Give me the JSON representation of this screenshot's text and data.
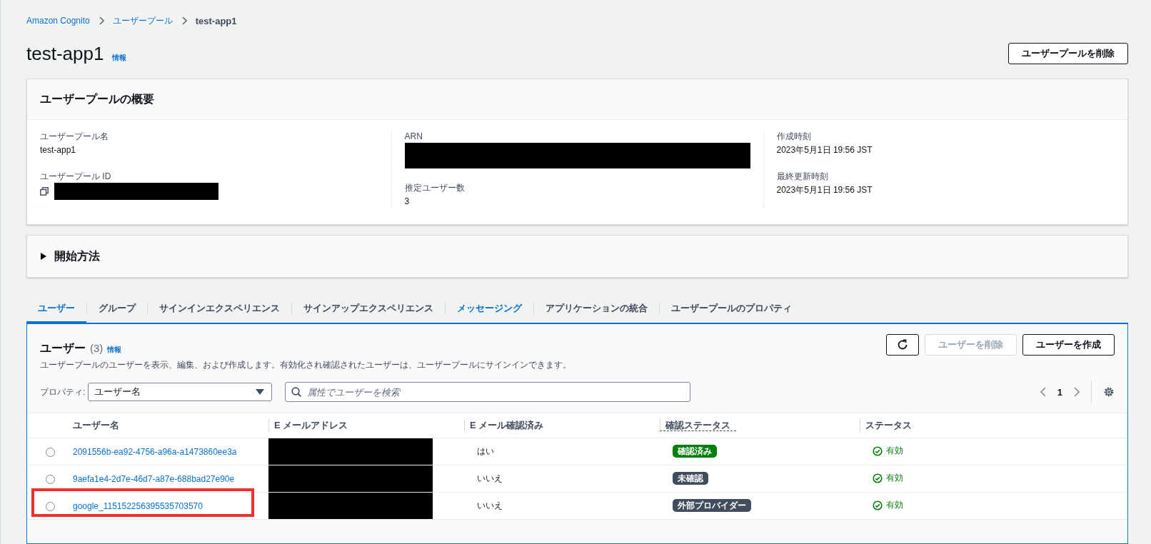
{
  "breadcrumbs": [
    {
      "label": "Amazon Cognito",
      "kind": "link"
    },
    {
      "label": "ユーザープール",
      "kind": "link"
    },
    {
      "label": "test-app1",
      "kind": "current"
    }
  ],
  "header": {
    "title": "test-app1",
    "info": "情報",
    "button": "ユーザープールを削除"
  },
  "overview": {
    "title": "ユーザープールの概要",
    "columns": [
      [
        {
          "label": "ユーザープール名",
          "value": "test-app1",
          "redacted": false,
          "copy": false
        },
        {
          "label": "ユーザープール ID",
          "redacted": true,
          "copy": true
        }
      ],
      [
        {
          "label": "ARN",
          "redacted": true,
          "copy": false
        },
        {
          "label": "推定ユーザー数",
          "value": "3",
          "redacted": false,
          "copy": false
        }
      ],
      [
        {
          "label": "作成時刻",
          "value": "2023年5月1日 19:56 JST",
          "redacted": false,
          "copy": false
        },
        {
          "label": "最終更新時刻",
          "value": "2023年5月1日 19:56 JST",
          "redacted": false,
          "copy": false
        }
      ]
    ]
  },
  "getting_started": {
    "title": "開始方法",
    "expanded": false
  },
  "tabs": [
    {
      "label": "ユーザー",
      "selected": true,
      "hovered": false
    },
    {
      "label": "グループ",
      "selected": false,
      "hovered": false
    },
    {
      "label": "サインインエクスペリエンス",
      "selected": false,
      "hovered": false
    },
    {
      "label": "サインアップエクスペリエンス",
      "selected": false,
      "hovered": false
    },
    {
      "label": "メッセージング",
      "selected": false,
      "hovered": true
    },
    {
      "label": "アプリケーションの統合",
      "selected": false,
      "hovered": false
    },
    {
      "label": "ユーザープールのプロパティ",
      "selected": false,
      "hovered": false
    }
  ],
  "users": {
    "title": "ユーザー",
    "count": "(3)",
    "info": "情報",
    "description": "ユーザープールのユーザーを表示、編集、および作成します。有効化され確認されたユーザーは、ユーザープールにサインインできます。",
    "buttons": [
      {
        "kind": "refresh",
        "disabled": false
      },
      {
        "kind": "text",
        "label": "ユーザーを削除",
        "disabled": true
      },
      {
        "kind": "text",
        "label": "ユーザーを作成",
        "disabled": false
      }
    ],
    "property_label": "プロパティ:",
    "property_value": "ユーザー名",
    "search_placeholder": "属性でユーザーを検索",
    "page": "1",
    "columns": [
      {
        "label": "ユーザー名",
        "kind": "plain"
      },
      {
        "label": "E メールアドレス",
        "kind": "plain"
      },
      {
        "label": "E メール確認済み",
        "kind": "plain"
      },
      {
        "label": "確認ステータス",
        "kind": "tooltip"
      },
      {
        "label": "ステータス",
        "kind": "plain"
      }
    ],
    "rows": [
      {
        "selected": false,
        "highlighted": false,
        "name": "2091556b-ea92-4756-a96a-a1473860ee3a",
        "email_redacted": true,
        "email_verified": "はい",
        "confirmation": {
          "label": "確認済み",
          "color": "#037f0c"
        },
        "status": "有効"
      },
      {
        "selected": false,
        "highlighted": false,
        "name": "9aefa1e4-2d7e-46d7-a87e-688bad27e90e",
        "email_redacted": true,
        "email_verified": "いいえ",
        "confirmation": {
          "label": "未確認",
          "color": "#414d5c"
        },
        "status": "有効"
      },
      {
        "selected": false,
        "highlighted": true,
        "name": "google_115152256395535703570",
        "email_redacted": true,
        "email_verified": "いいえ",
        "confirmation": {
          "label": "外部プロバイダー",
          "color": "#414d5c"
        },
        "status": "有効"
      }
    ]
  }
}
